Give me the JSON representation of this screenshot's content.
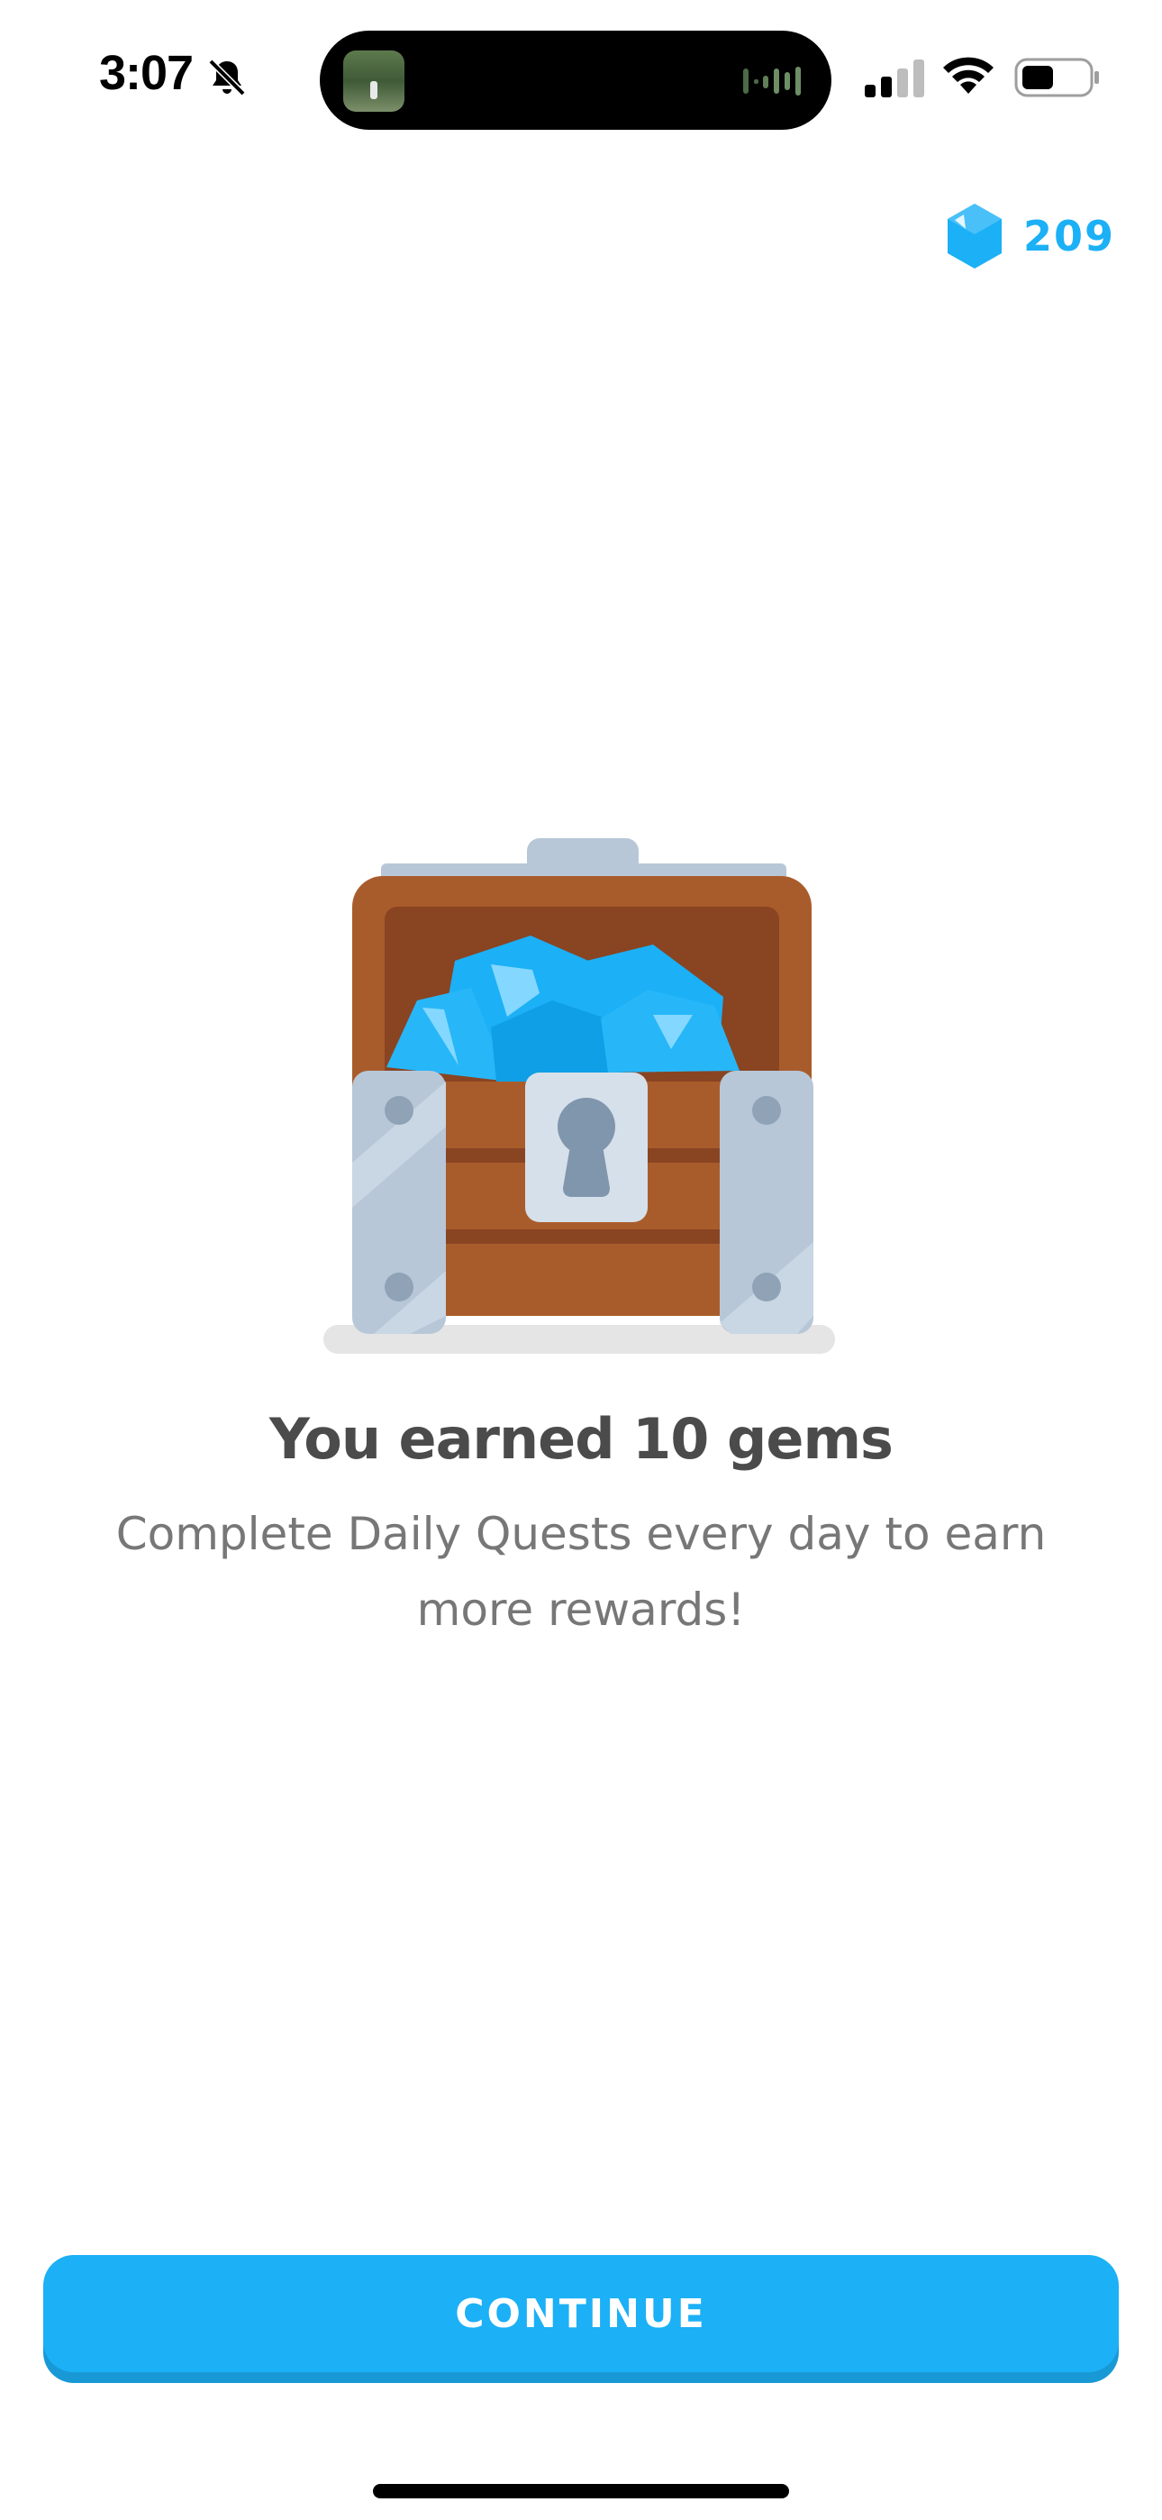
{
  "status_bar": {
    "time": "3:07",
    "icons": [
      "bell-slash-icon",
      "signal-icon",
      "wifi-icon",
      "battery-icon"
    ]
  },
  "gems": {
    "count": "209",
    "icon": "gem-icon",
    "color": "#1cb0f6"
  },
  "illustration": {
    "icon": "treasure-chest-icon"
  },
  "reward": {
    "headline": "You earned 10 gems",
    "message": "Complete Daily Quests every day to earn more rewards!"
  },
  "actions": {
    "continue_label": "CONTINUE"
  },
  "colors": {
    "accent": "#1cb0f6",
    "accent_shadow": "#1899d6",
    "headline": "#4b4b4b",
    "body_text": "#777777"
  }
}
